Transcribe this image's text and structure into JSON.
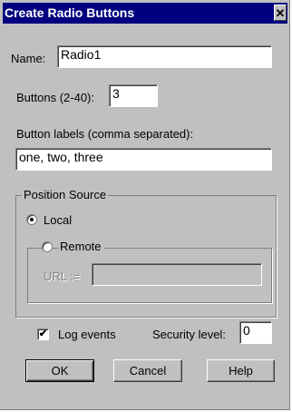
{
  "window": {
    "title": "Create Radio Buttons",
    "close_glyph": "✕"
  },
  "name": {
    "label": "Name:",
    "value": "Radio1"
  },
  "buttons": {
    "label": "Buttons (2-40):",
    "value": "3"
  },
  "labels": {
    "label": "Button labels (comma separated):",
    "value": "one, two, three"
  },
  "position_source": {
    "legend": "Position Source",
    "local_label": "Local",
    "local_selected": true,
    "remote_label": "Remote",
    "remote_selected": false,
    "url_label": "URL :=",
    "url_value": ""
  },
  "log_events": {
    "label": "Log events",
    "checked": true,
    "check_glyph": "✔"
  },
  "security": {
    "label": "Security level:",
    "value": "0"
  },
  "actions": {
    "ok": "OK",
    "cancel": "Cancel",
    "help": "Help"
  }
}
